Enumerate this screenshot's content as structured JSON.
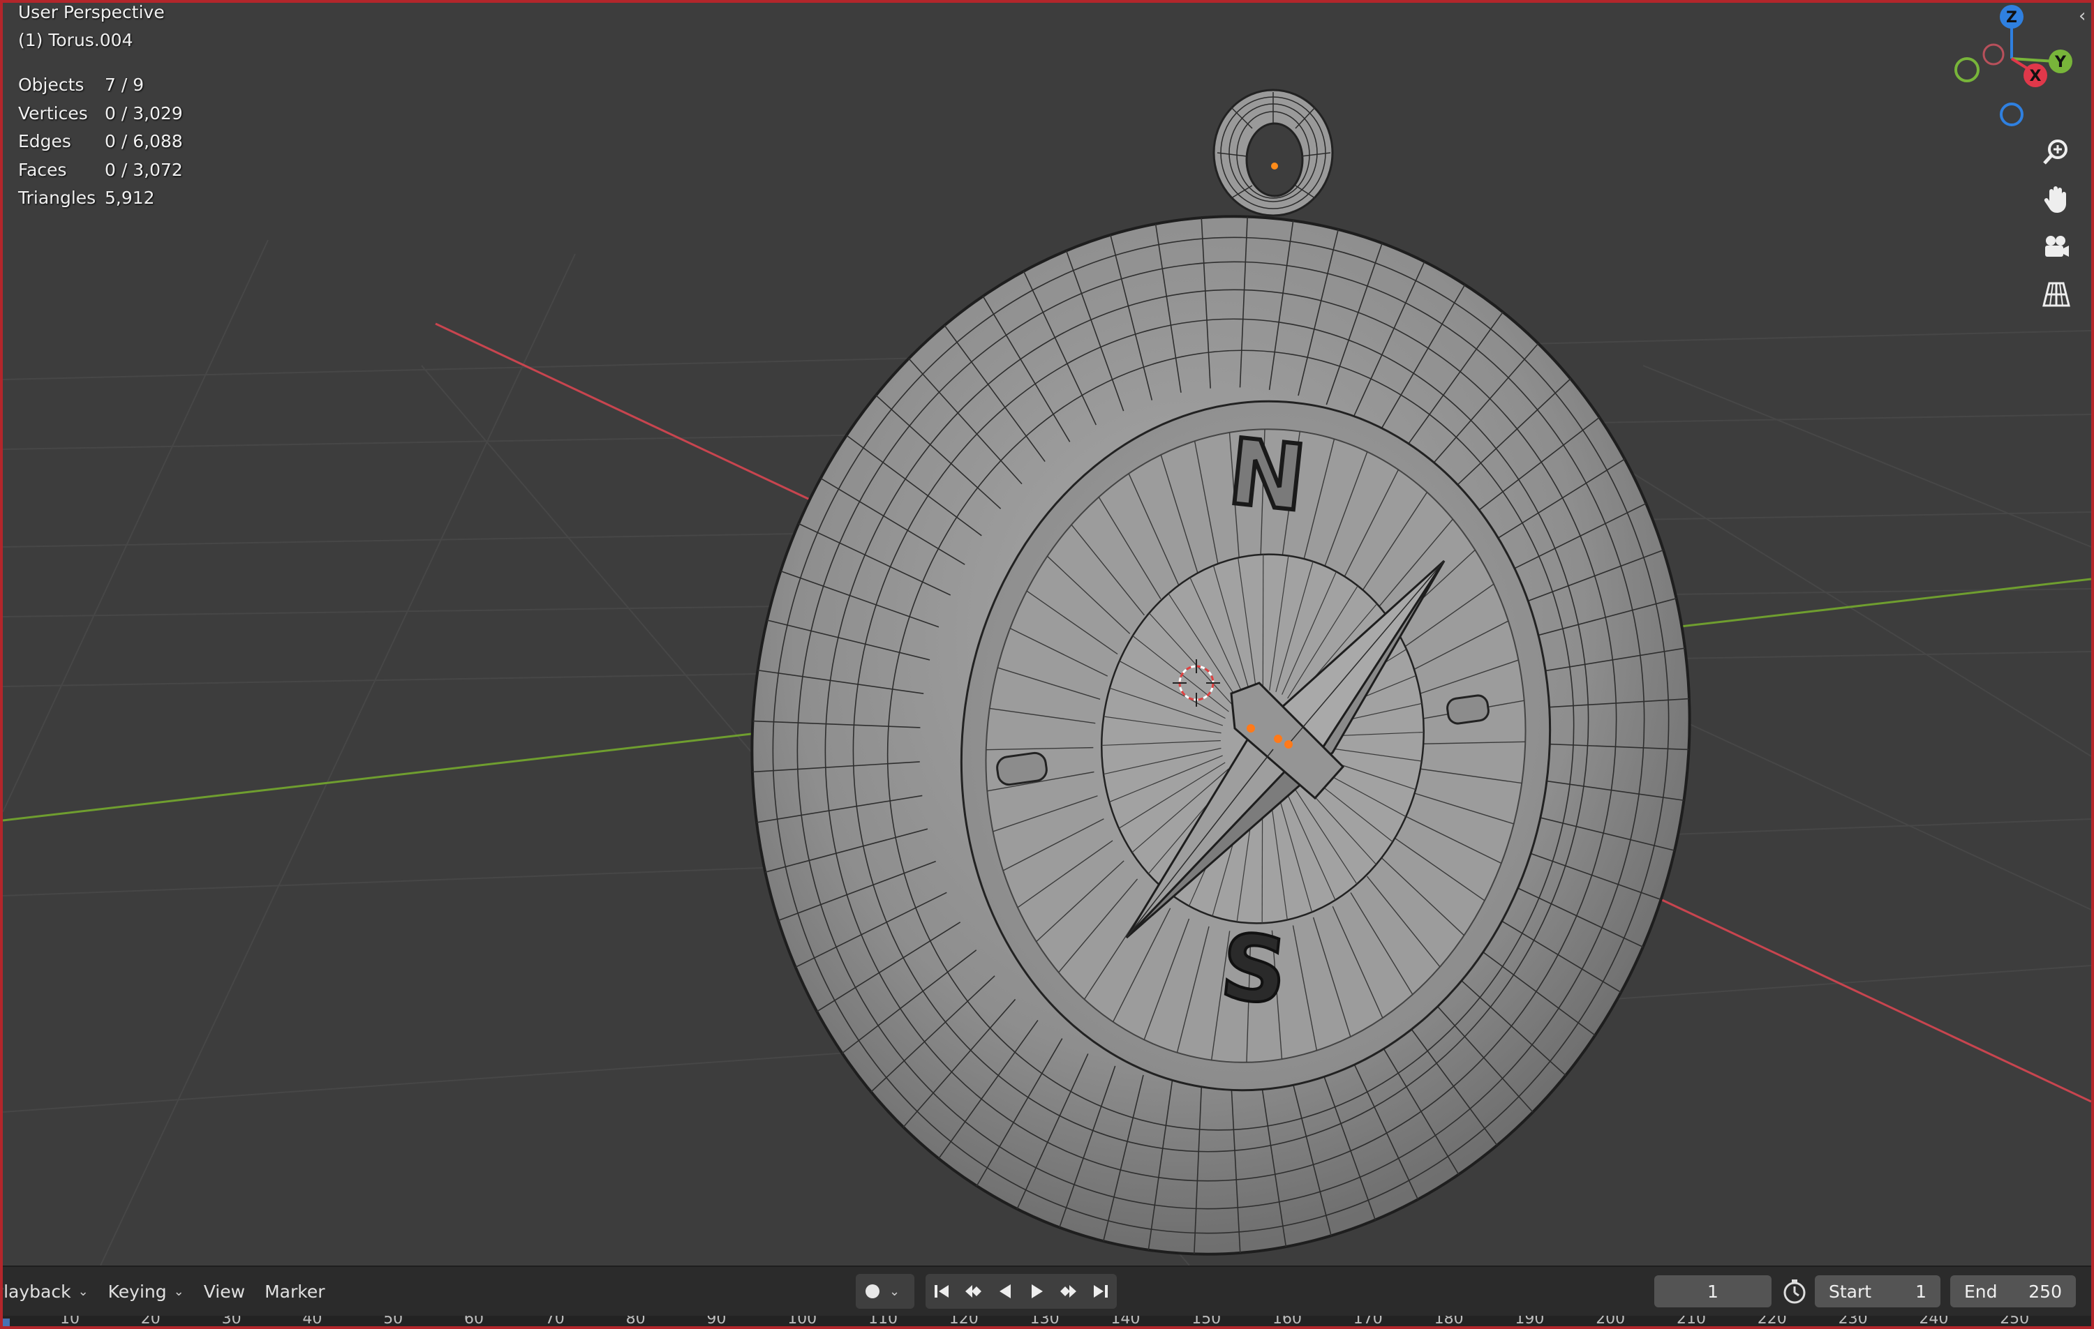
{
  "viewport": {
    "view_name": "User Perspective",
    "object_name": "(1) Torus.004",
    "stats": [
      {
        "label": "Objects",
        "value": "7 / 9"
      },
      {
        "label": "Vertices",
        "value": "0 / 3,029"
      },
      {
        "label": "Edges",
        "value": "0 / 6,088"
      },
      {
        "label": "Faces",
        "value": "0 / 3,072"
      },
      {
        "label": "Triangles",
        "value": "5,912"
      }
    ],
    "compass_letters": {
      "north": "N",
      "south": "S"
    },
    "gizmo": {
      "z": "Z",
      "y": "Y",
      "x": "X"
    },
    "nav_buttons": [
      "zoom-icon",
      "hand-pan-icon",
      "camera-icon",
      "grid-perspective-icon"
    ]
  },
  "colors": {
    "border": "#b3262b",
    "x_axis": "#c8454f",
    "y_axis": "#6f9e2f",
    "gizmo_z": "#2f80e0",
    "gizmo_y": "#78b53a",
    "gizmo_x": "#e0384a"
  },
  "timeline": {
    "menus": [
      {
        "label": "Playback",
        "dropdown": true
      },
      {
        "label": "Keying",
        "dropdown": true
      },
      {
        "label": "View",
        "dropdown": false
      },
      {
        "label": "Marker",
        "dropdown": false
      }
    ],
    "current_frame": "1",
    "start_label": "Start",
    "start_value": "1",
    "end_label": "End",
    "end_value": "250",
    "ruler_ticks": [
      "10",
      "20",
      "30",
      "40",
      "50",
      "60",
      "70",
      "80",
      "90",
      "100",
      "110",
      "120",
      "130",
      "140",
      "150",
      "160",
      "170",
      "180",
      "190",
      "200",
      "210",
      "220",
      "230",
      "240",
      "250"
    ]
  }
}
